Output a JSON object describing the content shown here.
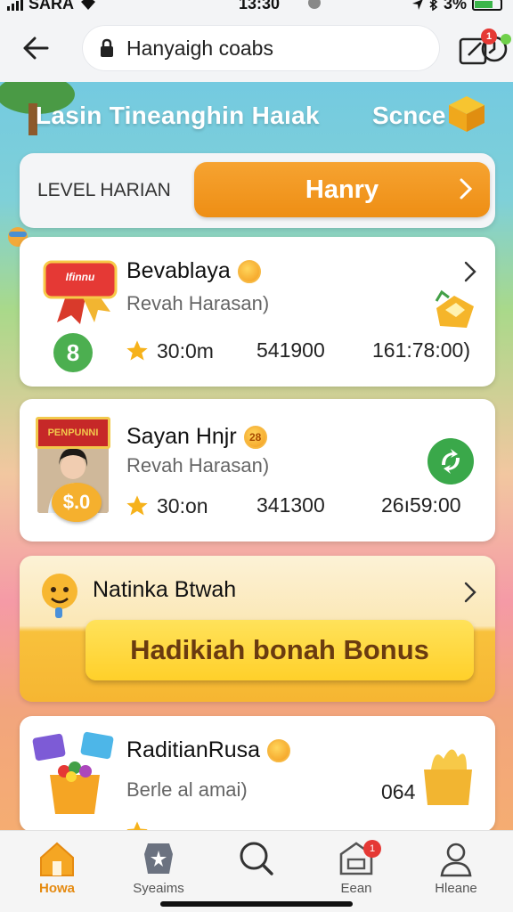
{
  "status_bar": {
    "carrier": "SARA",
    "time": "13:30",
    "battery": "3%"
  },
  "browser": {
    "url": "Hanyaigh coabs",
    "tabs_badge": "1"
  },
  "header": {
    "title": "Lasin Tineanghin Haıak",
    "scene_link": "Scnce"
  },
  "level": {
    "label": "LEVEL HARIAN",
    "button": "Hanry"
  },
  "items": [
    {
      "title": "Bevablaya",
      "subtitle": "Revah Harasan)",
      "thumb_text": "Ifinnu",
      "badge": "8",
      "rating": "30:0m",
      "count": "541900",
      "time": "161:78:00)"
    },
    {
      "title": "Sayan Hnjr",
      "coin_text": "28",
      "subtitle": "Revah Harasan)",
      "thumb_text": "PENPUNNI",
      "price": "$.0",
      "rating": "30:on",
      "count": "341300",
      "time": "26ı59:00"
    },
    {
      "title": "RaditianRusa",
      "subtitle": "Berle al amai)",
      "count": "064"
    }
  ],
  "promo": {
    "title": "Natinka Btwah",
    "button": "Hadikiah bonah Bonus"
  },
  "nav": [
    {
      "label": "Howa",
      "icon": "home-icon",
      "active": true
    },
    {
      "label": "Syeaims",
      "icon": "shield-icon"
    },
    {
      "label": "",
      "icon": "search-icon"
    },
    {
      "label": "Eean",
      "icon": "store-icon",
      "badge": "1"
    },
    {
      "label": "Hleane",
      "icon": "profile-icon"
    }
  ],
  "colors": {
    "accent": "#ee8e14",
    "promo_yellow": "#ffd02a",
    "success": "#4caf50",
    "alert": "#e53935"
  }
}
